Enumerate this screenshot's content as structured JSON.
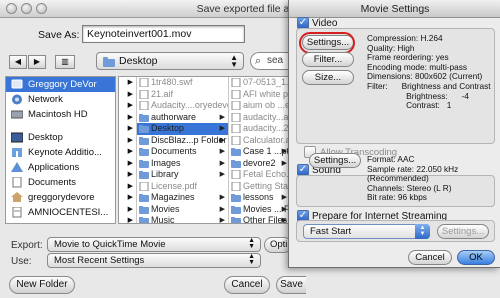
{
  "save_sheet": {
    "title": "Save exported file as...",
    "save_as_label": "Save As:",
    "filename": "Keynoteinvert001.mov",
    "location": "Desktop",
    "search_text": "sea",
    "sidebar": [
      {
        "label": "Greggory DeVor",
        "icon": "idisk-icon",
        "selected": true
      },
      {
        "label": "Network",
        "icon": "network-icon"
      },
      {
        "label": "Macintosh HD",
        "icon": "hard-drive-icon"
      },
      {
        "label": "Desktop",
        "icon": "desktop-folder-icon"
      },
      {
        "label": "Keynote Additio...",
        "icon": "keynote-icon"
      },
      {
        "label": "Applications",
        "icon": "applications-icon"
      },
      {
        "label": "Documents",
        "icon": "documents-icon"
      },
      {
        "label": "greggorydevore",
        "icon": "home-icon"
      },
      {
        "label": "AMNIOCENTESI...",
        "icon": "document-icon"
      }
    ],
    "col1": [
      "",
      "",
      "",
      "",
      "",
      "",
      "",
      "",
      "",
      "",
      "",
      "",
      ""
    ],
    "col2": [
      {
        "label": "1tr480.swf",
        "dim": true
      },
      {
        "label": "21.aif",
        "dim": true
      },
      {
        "label": "Audacity....oryedevore",
        "dim": true
      },
      {
        "label": "authorware",
        "more": true
      },
      {
        "label": "Desktop",
        "more": true,
        "selected": true
      },
      {
        "label": "DiscBlaz...p Folder",
        "more": true
      },
      {
        "label": "Documents",
        "more": true
      },
      {
        "label": "Images",
        "more": true
      },
      {
        "label": "Library",
        "more": true
      },
      {
        "label": "License.pdf",
        "dim": true
      },
      {
        "label": "Magazines",
        "more": true
      },
      {
        "label": "Movies",
        "more": true
      },
      {
        "label": "Music",
        "more": true
      }
    ],
    "col3": [
      {
        "label": "07-0513_1...",
        "dim": true
      },
      {
        "label": "AFI white pap...",
        "dim": true
      },
      {
        "label": "aium ob ...el...",
        "dim": true
      },
      {
        "label": "audacity...al...",
        "dim": true
      },
      {
        "label": "audacity...2...",
        "dim": true
      },
      {
        "label": "Calculator.app",
        "dim": true
      },
      {
        "label": "Case 1 ...pt...",
        "more": true
      },
      {
        "label": "devore2",
        "more": true
      },
      {
        "label": "Fetal Echo.zip",
        "dim": true
      },
      {
        "label": "Getting Start...",
        "dim": true
      },
      {
        "label": "lessons",
        "more": true
      },
      {
        "label": "Movies ... Po...",
        "more": true
      },
      {
        "label": "Other Files",
        "more": true
      }
    ],
    "export_label": "Export:",
    "export_value": "Movie to QuickTime Movie",
    "use_label": "Use:",
    "use_value": "Most Recent Settings",
    "options_label": "Opti",
    "new_folder_label": "New Folder",
    "cancel_label": "Cancel",
    "save_label": "Save"
  },
  "movie_settings": {
    "title": "Movie Settings",
    "video_label": "Video",
    "settings_label": "Settings...",
    "filter_label": "Filter...",
    "size_label": "Size...",
    "video_info": "Compression: H.264\nQuality: High\nFrame reordering: yes\nEncoding mode: multi-pass\nDimensions: 800x602 (Current)\nFilter:      Brightness and Contrast\n                 Brightness:      -4\n                 Contrast:   1",
    "allow_transcoding_label": "Allow Transcoding",
    "sound_label": "Sound",
    "sound_settings_label": "Settings...",
    "sound_info": "Format: AAC\nSample rate: 22.050 kHz\n(Recommended)\nChannels: Stereo (L R)\nBit rate: 96 kbps",
    "streaming_label": "Prepare for Internet Streaming",
    "streaming_value": "Fast Start",
    "streaming_settings_label": "Settings...",
    "cancel_label": "Cancel",
    "ok_label": "OK",
    "video_checked": true,
    "sound_checked": true,
    "streaming_checked": true,
    "allow_transcoding_checked": false
  },
  "colors": {
    "selection": "#3875d7",
    "highlight_ring": "#d62020",
    "default_button": "#3a7fe0"
  }
}
